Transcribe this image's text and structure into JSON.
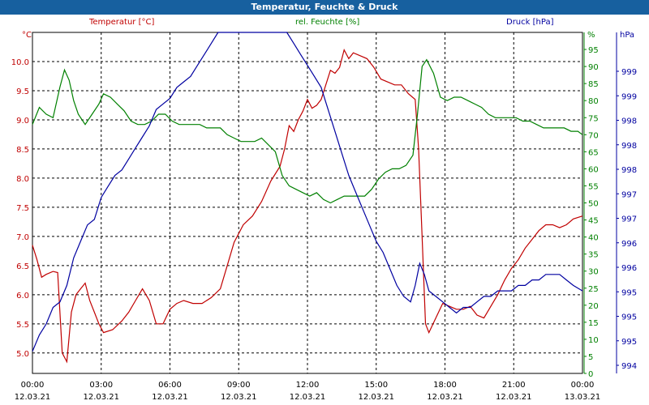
{
  "window": {
    "title": "Temperatur, Feuchte & Druck"
  },
  "colors": {
    "temperature": "#c00000",
    "humidity": "#008000",
    "pressure": "#0000a0",
    "title_bar": "#17609f",
    "grid": "#000000"
  },
  "chart_data": {
    "type": "line",
    "title": "Temperatur, Feuchte & Druck",
    "x_range": [
      "00:00 12.03.21",
      "00:00 13.03.21"
    ],
    "x_ticks": [
      {
        "time": "00:00",
        "date": "12.03.21"
      },
      {
        "time": "03:00",
        "date": "12.03.21"
      },
      {
        "time": "06:00",
        "date": "12.03.21"
      },
      {
        "time": "09:00",
        "date": "12.03.21"
      },
      {
        "time": "12:00",
        "date": "12.03.21"
      },
      {
        "time": "15:00",
        "date": "12.03.21"
      },
      {
        "time": "18:00",
        "date": "12.03.21"
      },
      {
        "time": "21:00",
        "date": "12.03.21"
      },
      {
        "time": "00:00",
        "date": "13.03.21"
      }
    ],
    "grid": true,
    "axes": {
      "left": {
        "label": "Temperatur [°C]",
        "unit": "°C",
        "min": 4.65,
        "max": 10.5,
        "ticks": [
          "5.0",
          "5.5",
          "6.0",
          "6.5",
          "7.0",
          "7.5",
          "8.0",
          "8.5",
          "9.0",
          "9.5",
          "10.0"
        ]
      },
      "right1": {
        "label": "rel. Feuchte [%]",
        "unit": "%",
        "min": 0,
        "max": 100,
        "ticks": [
          "0",
          "5",
          "10",
          "15",
          "20",
          "25",
          "30",
          "35",
          "40",
          "45",
          "50",
          "55",
          "60",
          "65",
          "70",
          "75",
          "80",
          "85",
          "90",
          "95"
        ]
      },
      "right2": {
        "label": "Druck [hPa]",
        "unit": "hPa",
        "min": 993.6,
        "max": 999.8,
        "tick_labels": [
          "994",
          "995",
          "995",
          "995",
          "996",
          "996",
          "997",
          "997",
          "998",
          "998",
          "998",
          "999",
          "999"
        ]
      }
    },
    "series": [
      {
        "name": "Temperatur [°C]",
        "axis": "left",
        "points": [
          [
            0,
            6.85
          ],
          [
            0.2,
            6.6
          ],
          [
            0.4,
            6.3
          ],
          [
            0.6,
            6.35
          ],
          [
            0.9,
            6.4
          ],
          [
            1.1,
            6.38
          ],
          [
            1.3,
            5.0
          ],
          [
            1.5,
            4.85
          ],
          [
            1.7,
            5.7
          ],
          [
            1.9,
            6.0
          ],
          [
            2.1,
            6.1
          ],
          [
            2.3,
            6.2
          ],
          [
            2.5,
            5.9
          ],
          [
            2.7,
            5.7
          ],
          [
            2.9,
            5.5
          ],
          [
            3.1,
            5.35
          ],
          [
            3.5,
            5.4
          ],
          [
            3.9,
            5.55
          ],
          [
            4.2,
            5.7
          ],
          [
            4.5,
            5.9
          ],
          [
            4.8,
            6.1
          ],
          [
            5.1,
            5.9
          ],
          [
            5.4,
            5.5
          ],
          [
            5.7,
            5.5
          ],
          [
            6.0,
            5.75
          ],
          [
            6.3,
            5.85
          ],
          [
            6.6,
            5.9
          ],
          [
            7.0,
            5.85
          ],
          [
            7.4,
            5.85
          ],
          [
            7.8,
            5.95
          ],
          [
            8.2,
            6.1
          ],
          [
            8.5,
            6.5
          ],
          [
            8.8,
            6.9
          ],
          [
            9.2,
            7.2
          ],
          [
            9.6,
            7.35
          ],
          [
            10.0,
            7.6
          ],
          [
            10.4,
            7.95
          ],
          [
            10.8,
            8.2
          ],
          [
            11.0,
            8.5
          ],
          [
            11.2,
            8.9
          ],
          [
            11.4,
            8.8
          ],
          [
            11.6,
            9.0
          ],
          [
            11.8,
            9.15
          ],
          [
            12.0,
            9.35
          ],
          [
            12.2,
            9.2
          ],
          [
            12.4,
            9.25
          ],
          [
            12.6,
            9.35
          ],
          [
            12.8,
            9.6
          ],
          [
            13.0,
            9.85
          ],
          [
            13.2,
            9.8
          ],
          [
            13.4,
            9.9
          ],
          [
            13.6,
            10.2
          ],
          [
            13.8,
            10.05
          ],
          [
            14.0,
            10.15
          ],
          [
            14.3,
            10.1
          ],
          [
            14.6,
            10.05
          ],
          [
            14.9,
            9.9
          ],
          [
            15.2,
            9.7
          ],
          [
            15.5,
            9.65
          ],
          [
            15.8,
            9.6
          ],
          [
            16.1,
            9.6
          ],
          [
            16.4,
            9.45
          ],
          [
            16.7,
            9.35
          ],
          [
            16.85,
            8.5
          ],
          [
            17.0,
            7.0
          ],
          [
            17.15,
            5.5
          ],
          [
            17.3,
            5.35
          ],
          [
            17.6,
            5.6
          ],
          [
            17.9,
            5.85
          ],
          [
            18.2,
            5.8
          ],
          [
            18.5,
            5.75
          ],
          [
            18.8,
            5.75
          ],
          [
            19.1,
            5.8
          ],
          [
            19.4,
            5.65
          ],
          [
            19.7,
            5.6
          ],
          [
            20.0,
            5.8
          ],
          [
            20.3,
            6.0
          ],
          [
            20.6,
            6.25
          ],
          [
            20.9,
            6.45
          ],
          [
            21.2,
            6.6
          ],
          [
            21.5,
            6.8
          ],
          [
            21.8,
            6.95
          ],
          [
            22.1,
            7.1
          ],
          [
            22.4,
            7.2
          ],
          [
            22.7,
            7.2
          ],
          [
            23.0,
            7.15
          ],
          [
            23.3,
            7.2
          ],
          [
            23.6,
            7.3
          ],
          [
            24.0,
            7.35
          ]
        ]
      },
      {
        "name": "rel. Feuchte [%]",
        "axis": "right1",
        "points": [
          [
            0,
            73
          ],
          [
            0.3,
            78
          ],
          [
            0.6,
            76
          ],
          [
            0.9,
            75
          ],
          [
            1.2,
            84
          ],
          [
            1.4,
            89
          ],
          [
            1.6,
            86
          ],
          [
            1.8,
            80
          ],
          [
            2.0,
            76
          ],
          [
            2.3,
            73
          ],
          [
            2.6,
            76
          ],
          [
            2.9,
            79
          ],
          [
            3.1,
            82
          ],
          [
            3.4,
            81
          ],
          [
            3.7,
            79
          ],
          [
            4.0,
            77
          ],
          [
            4.3,
            74
          ],
          [
            4.6,
            73
          ],
          [
            4.9,
            73
          ],
          [
            5.2,
            74
          ],
          [
            5.5,
            76
          ],
          [
            5.8,
            76
          ],
          [
            6.1,
            74
          ],
          [
            6.4,
            73
          ],
          [
            6.7,
            73
          ],
          [
            7.0,
            73
          ],
          [
            7.3,
            73
          ],
          [
            7.6,
            72
          ],
          [
            7.9,
            72
          ],
          [
            8.2,
            72
          ],
          [
            8.5,
            70
          ],
          [
            8.8,
            69
          ],
          [
            9.1,
            68
          ],
          [
            9.4,
            68
          ],
          [
            9.7,
            68
          ],
          [
            10.0,
            69
          ],
          [
            10.3,
            67
          ],
          [
            10.6,
            65
          ],
          [
            10.9,
            58
          ],
          [
            11.2,
            55
          ],
          [
            11.5,
            54
          ],
          [
            11.8,
            53
          ],
          [
            12.1,
            52
          ],
          [
            12.4,
            53
          ],
          [
            12.7,
            51
          ],
          [
            13.0,
            50
          ],
          [
            13.3,
            51
          ],
          [
            13.6,
            52
          ],
          [
            13.9,
            52
          ],
          [
            14.2,
            52
          ],
          [
            14.5,
            52
          ],
          [
            14.8,
            54
          ],
          [
            15.1,
            57
          ],
          [
            15.4,
            59
          ],
          [
            15.7,
            60
          ],
          [
            16.0,
            60
          ],
          [
            16.3,
            61
          ],
          [
            16.6,
            64
          ],
          [
            16.8,
            76
          ],
          [
            17.0,
            90
          ],
          [
            17.2,
            92
          ],
          [
            17.5,
            88
          ],
          [
            17.8,
            81
          ],
          [
            18.1,
            80
          ],
          [
            18.4,
            81
          ],
          [
            18.7,
            81
          ],
          [
            19.0,
            80
          ],
          [
            19.3,
            79
          ],
          [
            19.6,
            78
          ],
          [
            19.9,
            76
          ],
          [
            20.2,
            75
          ],
          [
            20.5,
            75
          ],
          [
            20.8,
            75
          ],
          [
            21.1,
            75
          ],
          [
            21.4,
            74
          ],
          [
            21.7,
            74
          ],
          [
            22.0,
            73
          ],
          [
            22.3,
            72
          ],
          [
            22.6,
            72
          ],
          [
            22.9,
            72
          ],
          [
            23.2,
            72
          ],
          [
            23.5,
            71
          ],
          [
            23.8,
            71
          ],
          [
            24.0,
            70
          ]
        ]
      },
      {
        "name": "Druck [hPa]",
        "axis": "right2",
        "points": [
          [
            0,
            994.0
          ],
          [
            0.3,
            994.3
          ],
          [
            0.6,
            994.5
          ],
          [
            0.9,
            994.8
          ],
          [
            1.2,
            994.9
          ],
          [
            1.5,
            995.2
          ],
          [
            1.8,
            995.7
          ],
          [
            2.1,
            996.0
          ],
          [
            2.4,
            996.3
          ],
          [
            2.7,
            996.4
          ],
          [
            3.0,
            996.8
          ],
          [
            3.3,
            997.0
          ],
          [
            3.6,
            997.2
          ],
          [
            3.9,
            997.3
          ],
          [
            4.2,
            997.5
          ],
          [
            4.5,
            997.7
          ],
          [
            4.8,
            997.9
          ],
          [
            5.1,
            998.1
          ],
          [
            5.4,
            998.4
          ],
          [
            5.7,
            998.5
          ],
          [
            6.0,
            998.6
          ],
          [
            6.3,
            998.8
          ],
          [
            6.6,
            998.9
          ],
          [
            6.9,
            999.0
          ],
          [
            7.2,
            999.2
          ],
          [
            7.5,
            999.4
          ],
          [
            7.8,
            999.6
          ],
          [
            8.1,
            999.8
          ],
          [
            8.4,
            1000.0
          ],
          [
            8.7,
            1000.1
          ],
          [
            9.0,
            1000.1
          ],
          [
            9.3,
            1000.2
          ],
          [
            9.6,
            1000.3
          ],
          [
            9.9,
            1000.2
          ],
          [
            10.2,
            1000.2
          ],
          [
            10.5,
            1000.1
          ],
          [
            10.8,
            1000.0
          ],
          [
            11.1,
            999.8
          ],
          [
            11.4,
            999.6
          ],
          [
            11.7,
            999.4
          ],
          [
            12.0,
            999.2
          ],
          [
            12.3,
            999.0
          ],
          [
            12.6,
            998.8
          ],
          [
            12.9,
            998.4
          ],
          [
            13.2,
            998.0
          ],
          [
            13.5,
            997.6
          ],
          [
            13.8,
            997.2
          ],
          [
            14.1,
            996.9
          ],
          [
            14.4,
            996.6
          ],
          [
            14.7,
            996.3
          ],
          [
            15.0,
            996.0
          ],
          [
            15.3,
            995.8
          ],
          [
            15.6,
            995.5
          ],
          [
            15.9,
            995.2
          ],
          [
            16.2,
            995.0
          ],
          [
            16.5,
            994.9
          ],
          [
            16.7,
            995.2
          ],
          [
            16.9,
            995.6
          ],
          [
            17.1,
            995.4
          ],
          [
            17.3,
            995.1
          ],
          [
            17.6,
            995.0
          ],
          [
            17.9,
            994.9
          ],
          [
            18.2,
            994.8
          ],
          [
            18.5,
            994.7
          ],
          [
            18.8,
            994.8
          ],
          [
            19.1,
            994.8
          ],
          [
            19.4,
            994.9
          ],
          [
            19.7,
            995.0
          ],
          [
            20.0,
            995.0
          ],
          [
            20.3,
            995.1
          ],
          [
            20.6,
            995.1
          ],
          [
            20.9,
            995.1
          ],
          [
            21.2,
            995.2
          ],
          [
            21.5,
            995.2
          ],
          [
            21.8,
            995.3
          ],
          [
            22.1,
            995.3
          ],
          [
            22.4,
            995.4
          ],
          [
            22.7,
            995.4
          ],
          [
            23.0,
            995.4
          ],
          [
            23.3,
            995.3
          ],
          [
            23.6,
            995.2
          ],
          [
            24.0,
            995.1
          ]
        ]
      }
    ]
  }
}
